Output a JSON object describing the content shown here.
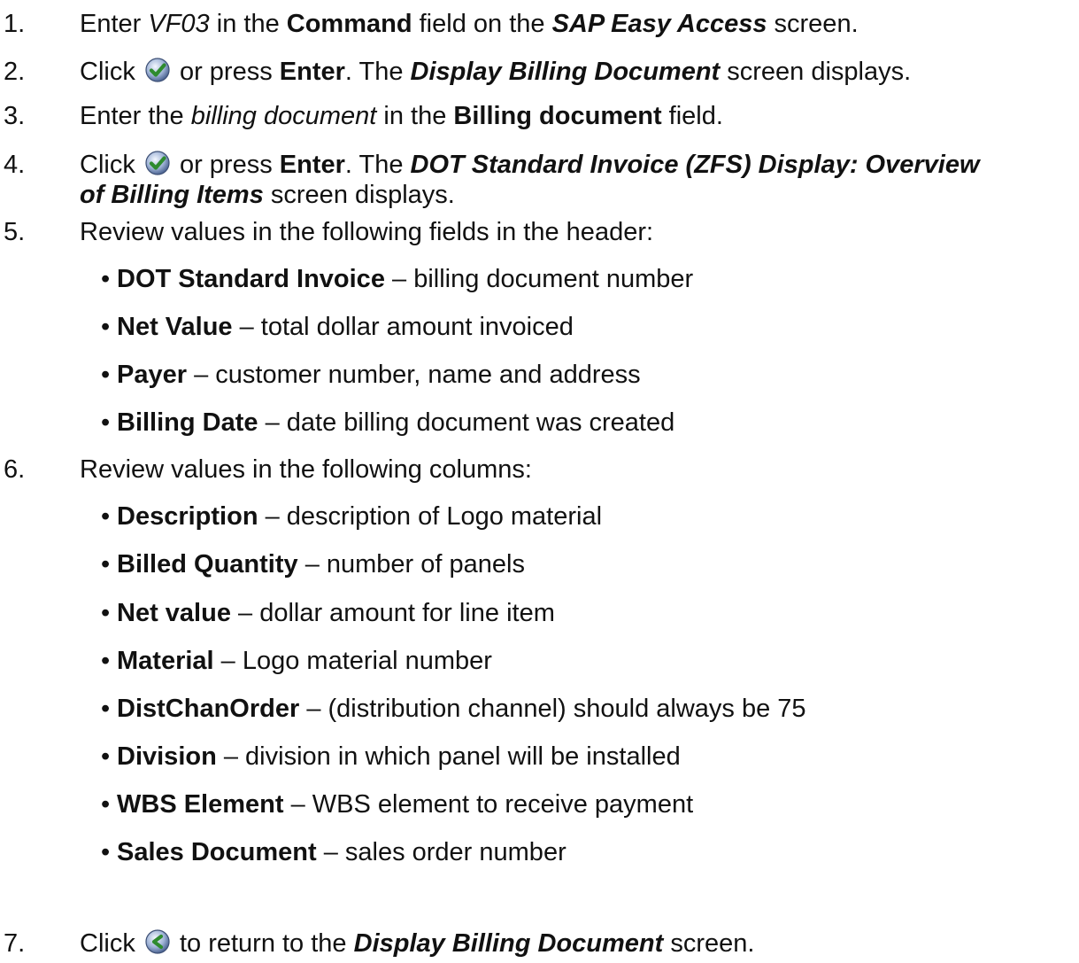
{
  "steps": [
    {
      "num": "1.",
      "parts": {
        "a": "Enter ",
        "b": "VF03",
        "c": " in the ",
        "d": "Command",
        "e": " field on the ",
        "f": "SAP Easy Access",
        "g": " screen."
      }
    },
    {
      "num": "2.",
      "parts": {
        "a": "Click ",
        "icon": "enter-check-icon",
        "b": " or press ",
        "c": "Enter",
        "d": ". The ",
        "e": "Display Billing Document",
        "f": " screen displays."
      }
    },
    {
      "num": "3.",
      "parts": {
        "a": "Enter the ",
        "b": "billing document",
        "c": " in the ",
        "d": "Billing document",
        "e": " field."
      }
    },
    {
      "num": "4.",
      "parts": {
        "a": "Click ",
        "icon": "enter-check-icon",
        "b": " or press ",
        "c": "Enter",
        "d": ". The ",
        "e": "DOT Standard Invoice (ZFS) Display: Overview",
        "f": "of Billing Items",
        "g": " screen displays."
      }
    },
    {
      "num": "5.",
      "text": "Review values in the following fields in the header:",
      "bullets": [
        {
          "term": "DOT Standard Invoice",
          "desc": " – billing document number"
        },
        {
          "term": "Net Value",
          "desc": " – total dollar amount invoiced"
        },
        {
          "term": "Payer",
          "desc": " – customer number, name and address"
        },
        {
          "term": "Billing Date",
          "desc": " – date billing document was created"
        }
      ]
    },
    {
      "num": "6.",
      "text": "Review values in the following columns:",
      "bullets": [
        {
          "term": "Description",
          "desc": " – description of Logo material"
        },
        {
          "term": "Billed Quantity",
          "desc": " – number of panels"
        },
        {
          "term": "Net value",
          "desc": " – dollar amount for line item"
        },
        {
          "term": "Material",
          "desc": " – Logo material number"
        },
        {
          "term": "DistChanOrder",
          "desc": " – (distribution channel) should always be 75"
        },
        {
          "term": "Division",
          "desc": " – division in which panel will be installed"
        },
        {
          "term": "WBS Element",
          "desc": " – WBS element to receive payment"
        },
        {
          "term": "Sales Document",
          "desc": " – sales order number"
        }
      ]
    },
    {
      "num": "7.",
      "parts": {
        "a": "Click ",
        "icon": "back-arrow-icon",
        "b": " to return to the ",
        "c": "Display Billing Document",
        "d": " screen."
      }
    }
  ],
  "bullet_char": "•"
}
